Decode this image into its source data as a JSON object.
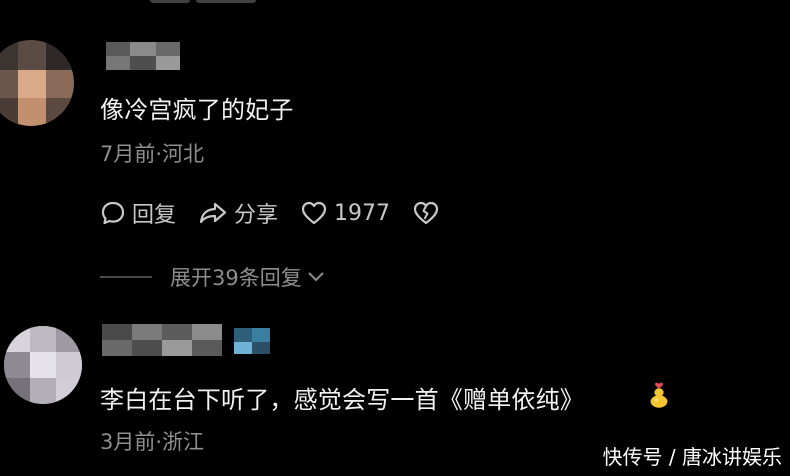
{
  "comments": [
    {
      "text": "像冷宫疯了的妃子",
      "meta": "7月前·河北",
      "actions": {
        "reply_label": "回复",
        "share_label": "分享",
        "like_count": "1977"
      },
      "expand_label": "展开39条回复"
    },
    {
      "text": "李白在台下听了，感觉会写一首《赠单依纯》",
      "meta": "3月前·浙江",
      "emoji_icon": "gourd-heart-emoji"
    }
  ],
  "watermark": "快传号 / 唐冰讲娱乐",
  "colors": {
    "background": "#000000",
    "comment_text": "#f2f2f2",
    "meta_text": "#8e8e8e",
    "action_text": "#c8c8c8"
  }
}
